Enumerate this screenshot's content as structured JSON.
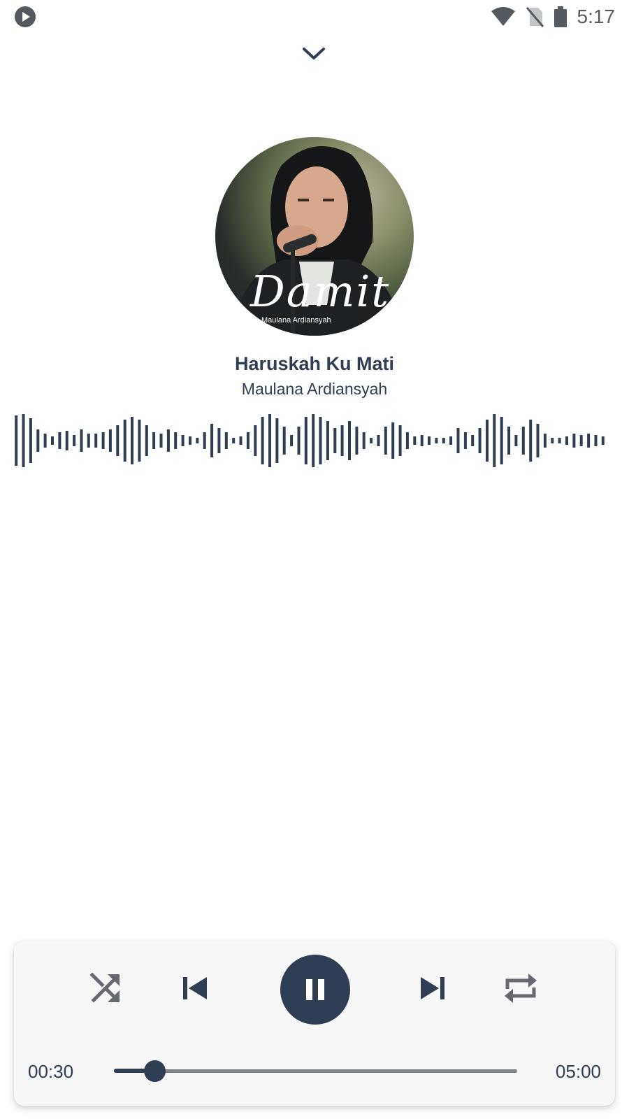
{
  "status_bar": {
    "time": "5:17",
    "icons": [
      "media-play-icon",
      "wifi-icon",
      "no-sim-icon",
      "battery-icon"
    ]
  },
  "header": {
    "collapse_icon": "chevron-down-icon"
  },
  "album": {
    "art_title": "Damit",
    "art_subtitle": "Maulana Ardiansyah"
  },
  "track": {
    "title": "Haruskah Ku Mati",
    "artist": "Maulana Ardiansyah"
  },
  "waveform": {
    "bars": [
      0.9,
      0.95,
      0.8,
      0.4,
      0.25,
      0.15,
      0.3,
      0.35,
      0.2,
      0.4,
      0.25,
      0.25,
      0.3,
      0.4,
      0.55,
      0.75,
      0.85,
      0.75,
      0.55,
      0.3,
      0.25,
      0.4,
      0.3,
      0.2,
      0.15,
      0.1,
      0.3,
      0.6,
      0.45,
      0.3,
      0.1,
      0.15,
      0.3,
      0.55,
      0.85,
      0.95,
      0.8,
      0.5,
      0.2,
      0.5,
      0.85,
      0.95,
      0.85,
      0.7,
      0.45,
      0.55,
      0.7,
      0.5,
      0.3,
      0.1,
      0.2,
      0.5,
      0.65,
      0.55,
      0.3,
      0.15,
      0.2,
      0.15,
      0.1,
      0.1,
      0.15,
      0.45,
      0.3,
      0.2,
      0.45,
      0.75,
      0.95,
      0.85,
      0.5,
      0.2,
      0.5,
      0.75,
      0.6,
      0.25,
      0.1,
      0.1,
      0.15,
      0.25,
      0.2,
      0.25,
      0.2,
      0.15
    ],
    "color": "#2f3e52"
  },
  "controls": {
    "shuffle_icon": "shuffle-icon",
    "previous_icon": "skip-previous-icon",
    "play_pause_icon": "pause-icon",
    "next_icon": "skip-next-icon",
    "repeat_icon": "repeat-icon"
  },
  "progress": {
    "current": "00:30",
    "total": "05:00",
    "fraction": 0.1
  },
  "colors": {
    "accent": "#2f3e52",
    "track": "#7b8288",
    "card_bg": "#f7f7f7",
    "icon_gray": "#666a70"
  }
}
